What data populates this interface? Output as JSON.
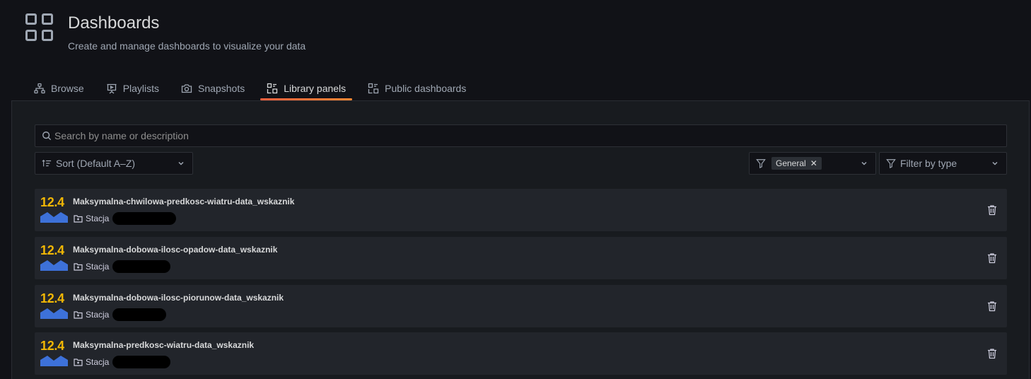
{
  "header": {
    "title": "Dashboards",
    "subtitle": "Create and manage dashboards to visualize your data",
    "icon": "apps-icon"
  },
  "tabs": [
    {
      "label": "Browse",
      "icon": "sitemap-icon",
      "active": false
    },
    {
      "label": "Playlists",
      "icon": "presentation-icon",
      "active": false
    },
    {
      "label": "Snapshots",
      "icon": "camera-icon",
      "active": false
    },
    {
      "label": "Library panels",
      "icon": "library-panel-icon",
      "active": true
    },
    {
      "label": "Public dashboards",
      "icon": "library-panel-icon",
      "active": false
    }
  ],
  "search": {
    "placeholder": "Search by name or description",
    "value": ""
  },
  "sort": {
    "label": "Sort (Default A–Z)"
  },
  "folder_filter": {
    "chip": "General"
  },
  "type_filter": {
    "placeholder": "Filter by type"
  },
  "panels": [
    {
      "stat": "12.4",
      "title": "Maksymalna-chwilowa-predkosc-wiatru-data_wskaznik",
      "folder": "Stacja"
    },
    {
      "stat": "12.4",
      "title": "Maksymalna-dobowa-ilosc-opadow-data_wskaznik",
      "folder": "Stacja"
    },
    {
      "stat": "12.4",
      "title": "Maksymalna-dobowa-ilosc-piorunow-data_wskaznik",
      "folder": "Stacja"
    },
    {
      "stat": "12.4",
      "title": "Maksymalna-predkosc-wiatru-data_wskaznik",
      "folder": "Stacja"
    }
  ],
  "colors": {
    "background": "#111217",
    "panel": "#181b1f",
    "row": "#22252b",
    "accent": "#ff8833",
    "stat": "#f2b705",
    "graph": "#3d71d9"
  }
}
